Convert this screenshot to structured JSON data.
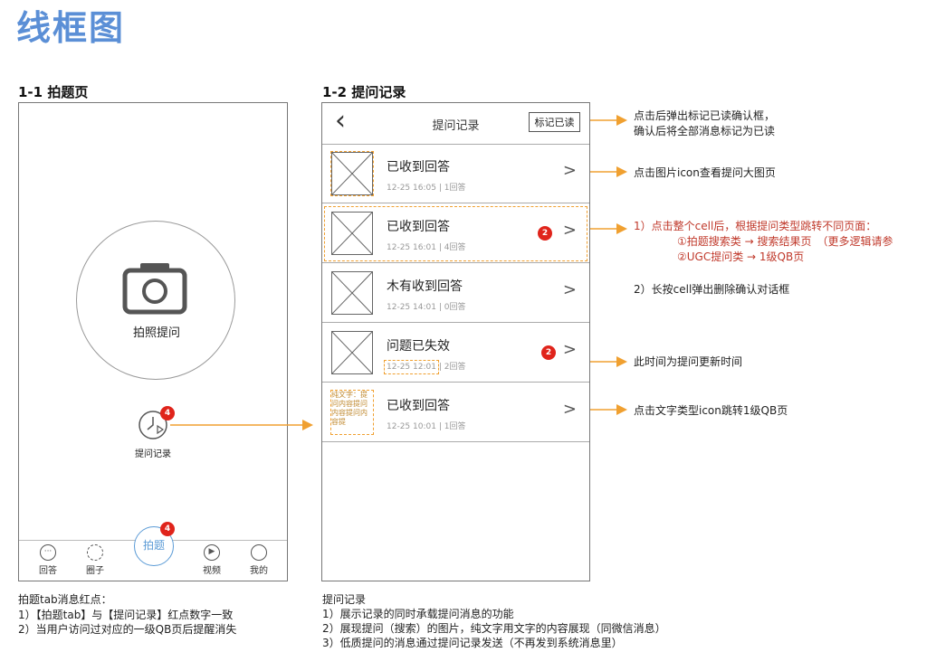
{
  "page_title": "线框图",
  "left": {
    "section_title": "1-1 拍题页",
    "camera_label": "拍照提问",
    "history_label": "提问记录",
    "history_badge": "4",
    "tabs": [
      {
        "label": "回答",
        "icon": "ellipsis-icon"
      },
      {
        "label": "圈子",
        "icon": "circle-dots-icon"
      },
      {
        "label": "拍题",
        "icon": "camera-tab-icon",
        "badge": "4",
        "active": true
      },
      {
        "label": "视频",
        "icon": "play-icon"
      },
      {
        "label": "我的",
        "icon": "user-icon"
      }
    ],
    "note_title": "拍题tab消息红点：",
    "note_lines": [
      "1）【拍题tab】与【提问记录】红点数字一致",
      "2）当用户访问过对应的一级QB页后提醒消失"
    ]
  },
  "right": {
    "section_title": "1-2 提问记录",
    "nav_title": "提问记录",
    "back_glyph": "‹",
    "mark_read_label": "标记已读",
    "cells": [
      {
        "title": "已收到回答",
        "time": "12-25 16:05",
        "count": "1回答",
        "badge": ""
      },
      {
        "title": "已收到回答",
        "time": "12-25 16:01",
        "count": "4回答",
        "badge": "2"
      },
      {
        "title": "木有收到回答",
        "time": "12-25 14:01",
        "count": "0回答",
        "badge": ""
      },
      {
        "title": "问题已失效",
        "time": "12-25 12:01",
        "count": "2回答",
        "badge": "2"
      },
      {
        "title": "已收到回答",
        "time": "12-25 10:01",
        "count": "1回答",
        "badge": "",
        "text_thumb": "纯文字：提问内容提问内容提问内容提"
      }
    ],
    "note_title": "提问记录",
    "note_lines": [
      "1）展示记录的同时承载提问消息的功能",
      "2）展现提问（搜索）的图片，纯文字用文字的内容展现（同微信消息）",
      "3）低质提问的消息通过提问记录发送（不再发到系统消息里）"
    ]
  },
  "annotations": {
    "a1_line1": "点击后弹出标记已读确认框，",
    "a1_line2": "确认后将全部消息标记为已读",
    "a2": "点击图片icon查看提问大图页",
    "a3_line1": "1）点击整个cell后，根据提问类型跳转不同页面：",
    "a3_line2": "①拍题搜索类 → 搜索结果页　（更多逻辑请参",
    "a3_line3": "②UGC提问类 → 1级QB页",
    "a4": "2）长按cell弹出删除确认对话框",
    "a5": "此时间为提问更新时间",
    "a6": "点击文字类型icon跳转1级QB页"
  },
  "colors": {
    "accent_orange": "#f0a030",
    "badge_red": "#e0241b",
    "title_blue": "#5b8fd6",
    "note_red": "#c0392b"
  }
}
